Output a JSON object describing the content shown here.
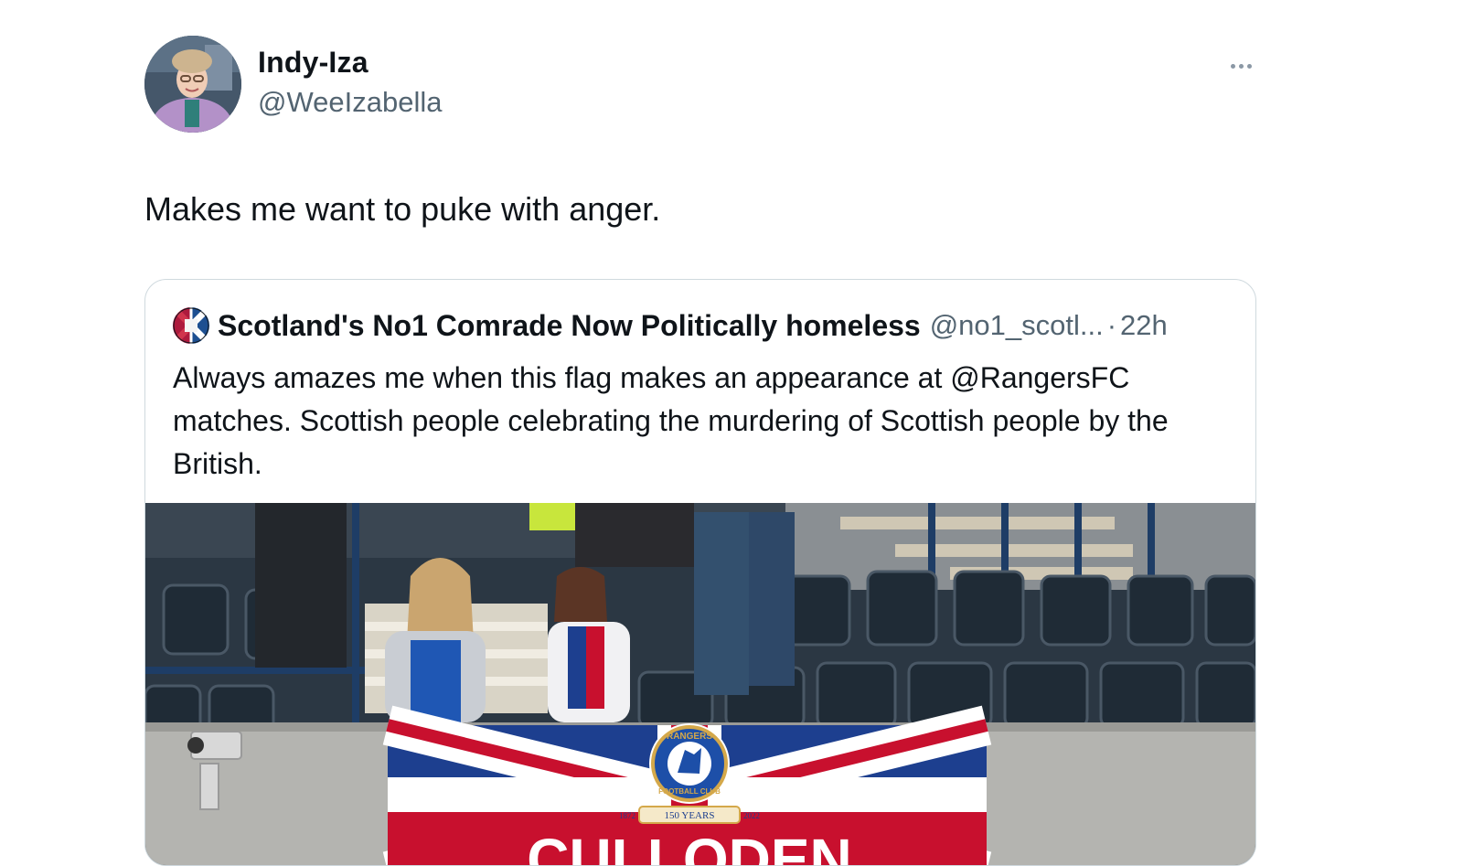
{
  "tweet": {
    "display_name": "Indy-Iza",
    "handle": "@WeeIzabella",
    "text": "Makes me want to puke with anger.",
    "more_icon": "more-horizontal-icon"
  },
  "quoted_tweet": {
    "display_name": "Scotland's No1 Comrade Now Politically homeless",
    "handle": "@no1_scotl...",
    "separator": "·",
    "time": "22h",
    "text": "Always amazes me when this flag makes an appearance at @RangersFC matches. Scottish people celebrating the murdering of Scottish people by the British."
  },
  "media": {
    "banner_text": "CULLODEN",
    "crest_top": "RANGERS",
    "crest_bottom": "FOOTBALL CLUB",
    "crest_ribbon": "150 YEARS",
    "crest_year_left": "1872",
    "crest_year_right": "2022"
  },
  "colors": {
    "text_primary": "#0f1419",
    "text_secondary": "#536471",
    "border": "#cfd9de"
  }
}
